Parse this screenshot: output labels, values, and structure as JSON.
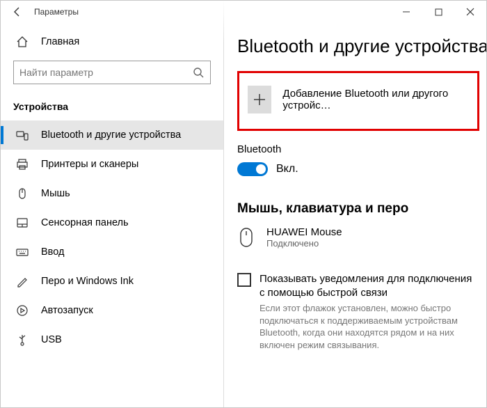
{
  "titlebar": {
    "title": "Параметры"
  },
  "sidebar": {
    "home": "Главная",
    "search_placeholder": "Найти параметр",
    "category": "Устройства",
    "items": [
      {
        "label": "Bluetooth и другие устройства"
      },
      {
        "label": "Принтеры и сканеры"
      },
      {
        "label": "Мышь"
      },
      {
        "label": "Сенсорная панель"
      },
      {
        "label": "Ввод"
      },
      {
        "label": "Перо и Windows Ink"
      },
      {
        "label": "Автозапуск"
      },
      {
        "label": "USB"
      }
    ]
  },
  "main": {
    "heading": "Bluetooth и другие устройства",
    "add_device": "Добавление Bluetooth или другого устройс…",
    "bt_label": "Bluetooth",
    "bt_state": "Вкл.",
    "section2": "Мышь, клавиатура и перо",
    "device_name": "HUAWEI  Mouse",
    "device_status": "Подключено",
    "checkbox_label": "Показывать уведомления для подключения с помощью быстрой связи",
    "help": "Если этот флажок установлен, можно быстро подключаться к поддерживаемым устройствам Bluetooth, когда они находятся рядом и на них включен режим связывания."
  }
}
